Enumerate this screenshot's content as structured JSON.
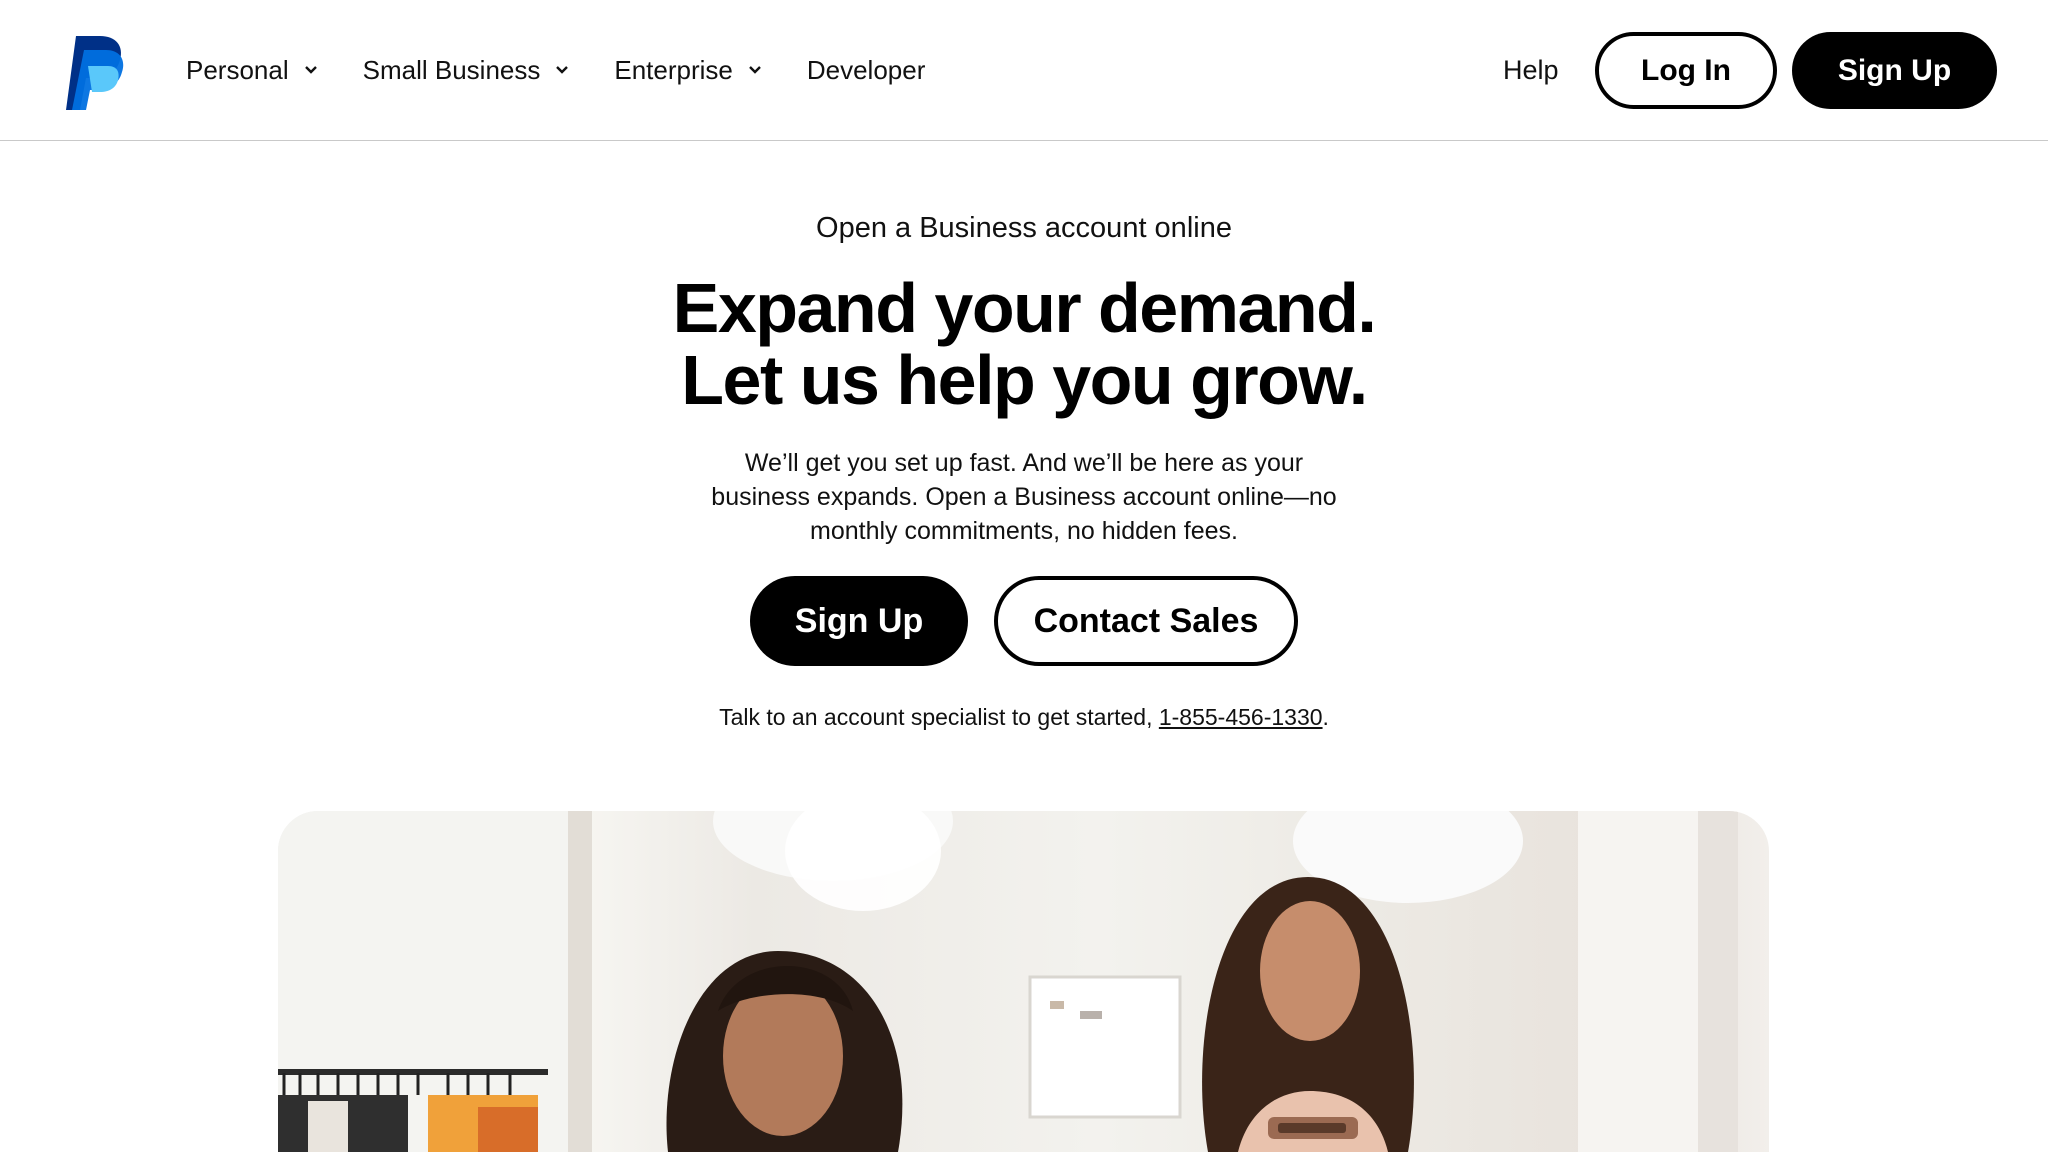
{
  "header": {
    "logo": {
      "icon": "paypal-logo-icon",
      "colors": [
        "#003087",
        "#0070e0",
        "#5ac8fa"
      ]
    },
    "nav": [
      {
        "label": "Personal",
        "has_dropdown": true
      },
      {
        "label": "Small Business",
        "has_dropdown": true
      },
      {
        "label": "Enterprise",
        "has_dropdown": true
      },
      {
        "label": "Developer",
        "has_dropdown": false
      }
    ],
    "help_label": "Help",
    "login_label": "Log In",
    "signup_label": "Sign Up"
  },
  "main": {
    "eyebrow": "Open a Business account online",
    "headline_line1": "Expand your demand.",
    "headline_line2": "Let us help you grow.",
    "subtext": "We’ll get you set up fast. And we’ll be here as your business expands. Open a Business account online—no monthly commitments, no hidden fees.",
    "signup_label": "Sign Up",
    "contact_label": "Contact Sales",
    "specialist_prefix": "Talk to an account specialist to get started, ",
    "phone": "1-855-456-1330",
    "specialist_suffix": "."
  },
  "hero_image": {
    "subject": "hero-photo-two-women-in-clothing-shop"
  },
  "colors": {
    "primary_button": "#000000",
    "primary_text": "#ffffff",
    "divider": "#c9c9c9"
  }
}
